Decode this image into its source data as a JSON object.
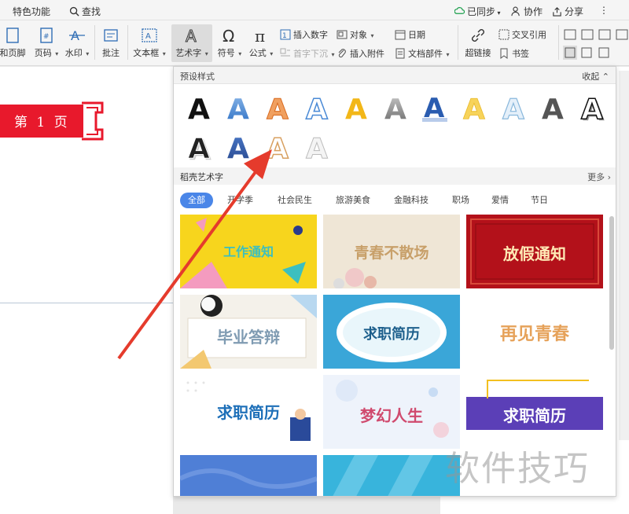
{
  "topbar": {
    "special": "特色功能",
    "search": "查找",
    "sync": "已同步",
    "collab": "协作",
    "share": "分享",
    "more": "⋮"
  },
  "ribbon": {
    "header_footer": "和页脚",
    "page_number": "页码",
    "watermark": "水印",
    "comment": "批注",
    "textbox": "文本框",
    "wordart": "艺术字",
    "symbol": "符号",
    "formula": "公式",
    "insert_number": "插入数字",
    "object": "对象",
    "date": "日期",
    "dropcap": "首字下沉",
    "attachment": "插入附件",
    "doc_parts": "文档部件",
    "hyperlink": "超链接",
    "cross_ref": "交叉引用",
    "bookmark": "书签"
  },
  "document": {
    "banner_text": "第 1 页",
    "banner_color": "#e8192c"
  },
  "panel": {
    "preset_title": "预设样式",
    "collapse": "收起",
    "wordart_title": "稻壳艺术字",
    "more": "更多",
    "preset_letter": "A",
    "categories": [
      "全部",
      "开学季",
      "社会民生",
      "旅游美食",
      "金融科技",
      "职场",
      "爱情",
      "节日"
    ],
    "cards": [
      {
        "text": "工作通知",
        "bg": "#f7d51d",
        "fg": "#3cbfbf"
      },
      {
        "text": "青春不散场",
        "bg": "#efe6d6",
        "fg": "#c8a06a"
      },
      {
        "text": "放假通知",
        "bg": "#b3111a",
        "fg": "#ffe9b5"
      },
      {
        "text": "毕业答辩",
        "bg": "#f4f1ea",
        "fg": "#7f9bb2"
      },
      {
        "text": "求职简历",
        "bg": "#3aa6d8",
        "fg": "#1d5f8c"
      },
      {
        "text": "再见青春",
        "bg": "#ffffff",
        "fg": "#e6a25a"
      },
      {
        "text": "求职简历",
        "bg": "#ffffff",
        "fg": "#1d6fb8"
      },
      {
        "text": "梦幻人生",
        "bg": "#eef3fb",
        "fg": "#d04a6e"
      },
      {
        "text": "求职简历",
        "bg": "#5b3fb7",
        "fg": "#ffffff"
      },
      {
        "text": "",
        "bg": "#4f7fd6",
        "fg": "#ffffff"
      },
      {
        "text": "",
        "bg": "#38b4dc",
        "fg": "#ffffff"
      }
    ]
  },
  "watermark": "软件技巧",
  "colors": {
    "accent": "#4a86e8",
    "arrow": "#e53b2c"
  }
}
